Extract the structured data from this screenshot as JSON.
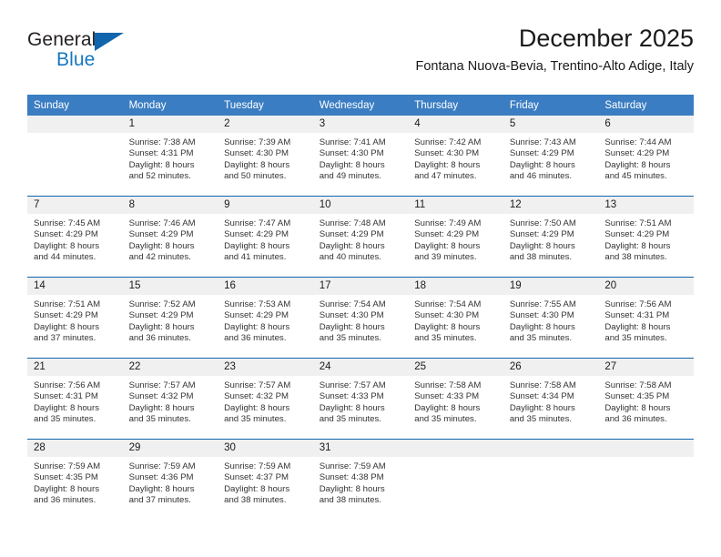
{
  "brand": {
    "word_one": "General",
    "word_two": "Blue",
    "flag_icon": "triangle-flag-icon"
  },
  "header": {
    "title": "December 2025",
    "location": "Fontana Nuova-Bevia, Trentino-Alto Adige, Italy"
  },
  "colors": {
    "header_blue": "#3b7dc2",
    "separator_blue": "#1065ad",
    "date_band": "#f0f0f0",
    "brand_blue": "#1477bf"
  },
  "weekday_headers": [
    "Sunday",
    "Monday",
    "Tuesday",
    "Wednesday",
    "Thursday",
    "Friday",
    "Saturday"
  ],
  "weeks": [
    [
      {
        "date": "",
        "lines": []
      },
      {
        "date": "1",
        "lines": [
          "Sunrise: 7:38 AM",
          "Sunset: 4:31 PM",
          "Daylight: 8 hours",
          "and 52 minutes."
        ]
      },
      {
        "date": "2",
        "lines": [
          "Sunrise: 7:39 AM",
          "Sunset: 4:30 PM",
          "Daylight: 8 hours",
          "and 50 minutes."
        ]
      },
      {
        "date": "3",
        "lines": [
          "Sunrise: 7:41 AM",
          "Sunset: 4:30 PM",
          "Daylight: 8 hours",
          "and 49 minutes."
        ]
      },
      {
        "date": "4",
        "lines": [
          "Sunrise: 7:42 AM",
          "Sunset: 4:30 PM",
          "Daylight: 8 hours",
          "and 47 minutes."
        ]
      },
      {
        "date": "5",
        "lines": [
          "Sunrise: 7:43 AM",
          "Sunset: 4:29 PM",
          "Daylight: 8 hours",
          "and 46 minutes."
        ]
      },
      {
        "date": "6",
        "lines": [
          "Sunrise: 7:44 AM",
          "Sunset: 4:29 PM",
          "Daylight: 8 hours",
          "and 45 minutes."
        ]
      }
    ],
    [
      {
        "date": "7",
        "lines": [
          "Sunrise: 7:45 AM",
          "Sunset: 4:29 PM",
          "Daylight: 8 hours",
          "and 44 minutes."
        ]
      },
      {
        "date": "8",
        "lines": [
          "Sunrise: 7:46 AM",
          "Sunset: 4:29 PM",
          "Daylight: 8 hours",
          "and 42 minutes."
        ]
      },
      {
        "date": "9",
        "lines": [
          "Sunrise: 7:47 AM",
          "Sunset: 4:29 PM",
          "Daylight: 8 hours",
          "and 41 minutes."
        ]
      },
      {
        "date": "10",
        "lines": [
          "Sunrise: 7:48 AM",
          "Sunset: 4:29 PM",
          "Daylight: 8 hours",
          "and 40 minutes."
        ]
      },
      {
        "date": "11",
        "lines": [
          "Sunrise: 7:49 AM",
          "Sunset: 4:29 PM",
          "Daylight: 8 hours",
          "and 39 minutes."
        ]
      },
      {
        "date": "12",
        "lines": [
          "Sunrise: 7:50 AM",
          "Sunset: 4:29 PM",
          "Daylight: 8 hours",
          "and 38 minutes."
        ]
      },
      {
        "date": "13",
        "lines": [
          "Sunrise: 7:51 AM",
          "Sunset: 4:29 PM",
          "Daylight: 8 hours",
          "and 38 minutes."
        ]
      }
    ],
    [
      {
        "date": "14",
        "lines": [
          "Sunrise: 7:51 AM",
          "Sunset: 4:29 PM",
          "Daylight: 8 hours",
          "and 37 minutes."
        ]
      },
      {
        "date": "15",
        "lines": [
          "Sunrise: 7:52 AM",
          "Sunset: 4:29 PM",
          "Daylight: 8 hours",
          "and 36 minutes."
        ]
      },
      {
        "date": "16",
        "lines": [
          "Sunrise: 7:53 AM",
          "Sunset: 4:29 PM",
          "Daylight: 8 hours",
          "and 36 minutes."
        ]
      },
      {
        "date": "17",
        "lines": [
          "Sunrise: 7:54 AM",
          "Sunset: 4:30 PM",
          "Daylight: 8 hours",
          "and 35 minutes."
        ]
      },
      {
        "date": "18",
        "lines": [
          "Sunrise: 7:54 AM",
          "Sunset: 4:30 PM",
          "Daylight: 8 hours",
          "and 35 minutes."
        ]
      },
      {
        "date": "19",
        "lines": [
          "Sunrise: 7:55 AM",
          "Sunset: 4:30 PM",
          "Daylight: 8 hours",
          "and 35 minutes."
        ]
      },
      {
        "date": "20",
        "lines": [
          "Sunrise: 7:56 AM",
          "Sunset: 4:31 PM",
          "Daylight: 8 hours",
          "and 35 minutes."
        ]
      }
    ],
    [
      {
        "date": "21",
        "lines": [
          "Sunrise: 7:56 AM",
          "Sunset: 4:31 PM",
          "Daylight: 8 hours",
          "and 35 minutes."
        ]
      },
      {
        "date": "22",
        "lines": [
          "Sunrise: 7:57 AM",
          "Sunset: 4:32 PM",
          "Daylight: 8 hours",
          "and 35 minutes."
        ]
      },
      {
        "date": "23",
        "lines": [
          "Sunrise: 7:57 AM",
          "Sunset: 4:32 PM",
          "Daylight: 8 hours",
          "and 35 minutes."
        ]
      },
      {
        "date": "24",
        "lines": [
          "Sunrise: 7:57 AM",
          "Sunset: 4:33 PM",
          "Daylight: 8 hours",
          "and 35 minutes."
        ]
      },
      {
        "date": "25",
        "lines": [
          "Sunrise: 7:58 AM",
          "Sunset: 4:33 PM",
          "Daylight: 8 hours",
          "and 35 minutes."
        ]
      },
      {
        "date": "26",
        "lines": [
          "Sunrise: 7:58 AM",
          "Sunset: 4:34 PM",
          "Daylight: 8 hours",
          "and 35 minutes."
        ]
      },
      {
        "date": "27",
        "lines": [
          "Sunrise: 7:58 AM",
          "Sunset: 4:35 PM",
          "Daylight: 8 hours",
          "and 36 minutes."
        ]
      }
    ],
    [
      {
        "date": "28",
        "lines": [
          "Sunrise: 7:59 AM",
          "Sunset: 4:35 PM",
          "Daylight: 8 hours",
          "and 36 minutes."
        ]
      },
      {
        "date": "29",
        "lines": [
          "Sunrise: 7:59 AM",
          "Sunset: 4:36 PM",
          "Daylight: 8 hours",
          "and 37 minutes."
        ]
      },
      {
        "date": "30",
        "lines": [
          "Sunrise: 7:59 AM",
          "Sunset: 4:37 PM",
          "Daylight: 8 hours",
          "and 38 minutes."
        ]
      },
      {
        "date": "31",
        "lines": [
          "Sunrise: 7:59 AM",
          "Sunset: 4:38 PM",
          "Daylight: 8 hours",
          "and 38 minutes."
        ]
      },
      {
        "date": "",
        "lines": []
      },
      {
        "date": "",
        "lines": []
      },
      {
        "date": "",
        "lines": []
      }
    ]
  ]
}
